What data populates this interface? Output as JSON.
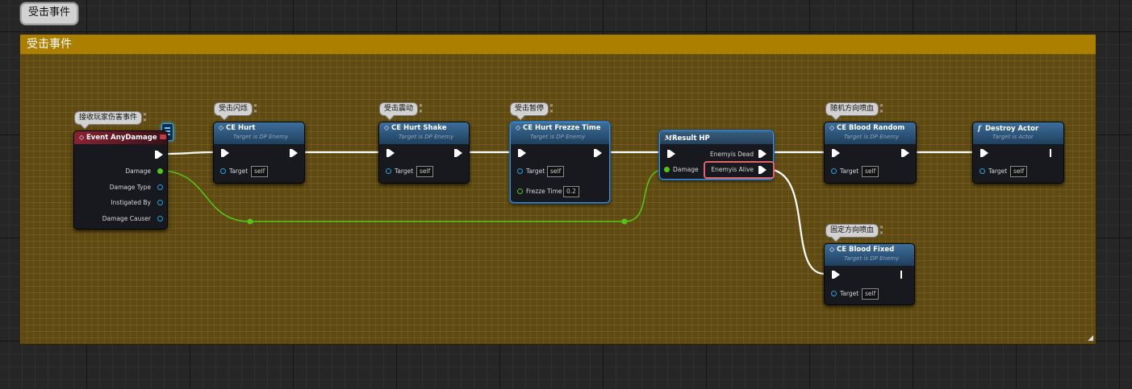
{
  "main_bubble": "受击事件",
  "comment_title": "受击事件",
  "bubbles": {
    "event": "接收玩家伤害事件",
    "hurt": "受击闪烁",
    "shake": "受击震动",
    "freeze": "受击暂停",
    "random": "随机方向喷血",
    "fixed": "固定方向喷血"
  },
  "nodes": {
    "event": {
      "title": "Event AnyDamage",
      "icon": "diamond-icon",
      "pins": [
        "Damage",
        "Damage Type",
        "Instigated By",
        "Damage Causer"
      ]
    },
    "hurt": {
      "title": "CE Hurt",
      "icon": "diamond-icon",
      "subtitle": "Target is DP Enemy",
      "target_label": "Target",
      "target_value": "self"
    },
    "shake": {
      "title": "CE Hurt Shake",
      "icon": "diamond-icon",
      "subtitle": "Target is DP Enemy",
      "target_label": "Target",
      "target_value": "self"
    },
    "freeze": {
      "title": "CE Hurt Frezze Time",
      "icon": "diamond-icon",
      "subtitle": "Target is DP Enemy",
      "target_label": "Target",
      "target_value": "self",
      "time_label": "Frezze Time",
      "time_value": "0.2"
    },
    "result": {
      "title": "Result HP",
      "icon": "macro-icon",
      "damage_label": "Damage",
      "out_dead": "Enemyis Dead",
      "out_alive": "Enemyis Alive"
    },
    "random": {
      "title": "CE Blood Random",
      "icon": "diamond-icon",
      "subtitle": "Target is DP Enemy",
      "target_label": "Target",
      "target_value": "self"
    },
    "destroy": {
      "title": "Destroy Actor",
      "icon": "function-icon",
      "subtitle": "Target is Actor",
      "target_label": "Target",
      "target_value": "self"
    },
    "fixed": {
      "title": "CE Blood Fixed",
      "icon": "diamond-icon",
      "subtitle": "Target is DP Enemy",
      "target_label": "Target",
      "target_value": "self"
    }
  },
  "colors": {
    "comment_header": "#ad7f00",
    "comment_body": "#5e4a12",
    "highlight": "#e0656a",
    "exec_wire": "#ffffff",
    "float_wire": "#52c41a",
    "object_pin": "#2aa0dc"
  }
}
